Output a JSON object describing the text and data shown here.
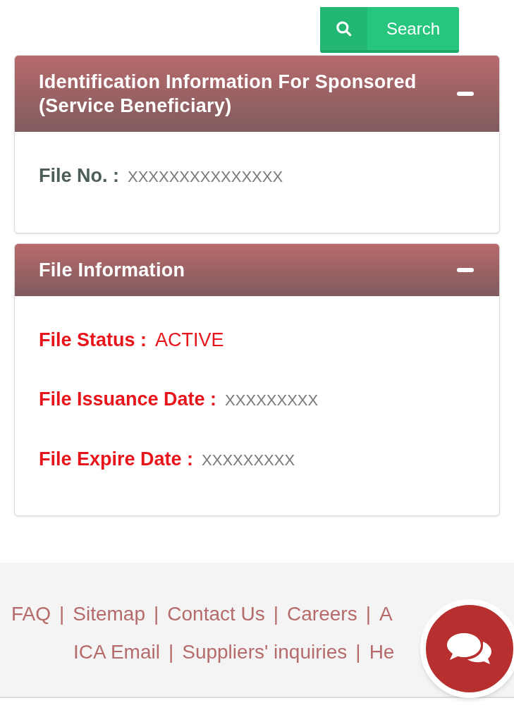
{
  "search_button": {
    "label": "Search"
  },
  "panels": [
    {
      "title": "Identification Information For Sponsored (Service Beneficiary)",
      "expanded": true,
      "fields": [
        {
          "kind": "plain",
          "label": "File No. :",
          "value": "XXXXXXXXXXXXXXX"
        }
      ]
    },
    {
      "title": "File Information",
      "expanded": true,
      "fields": [
        {
          "kind": "status",
          "label": "File Status :",
          "value": "ACTIVE"
        },
        {
          "kind": "date",
          "label": "File Issuance Date :",
          "value": "XXXXXXXXX"
        },
        {
          "kind": "date",
          "label": "File Expire Date :",
          "value": "XXXXXXXXX"
        }
      ]
    }
  ],
  "footer": {
    "lines": [
      {
        "links": [
          {
            "text": "FAQ",
            "separator": "|"
          },
          {
            "text": "Sitemap",
            "separator": "|"
          },
          {
            "text": "Contact Us",
            "separator": "|"
          },
          {
            "text": "Careers",
            "separator": "|"
          },
          {
            "text": "A"
          }
        ]
      },
      {
        "links": [
          {
            "text": "ICA Email",
            "separator": "|"
          },
          {
            "text": "Suppliers' inquiries",
            "separator": "|"
          },
          {
            "text": "He"
          }
        ]
      }
    ]
  }
}
